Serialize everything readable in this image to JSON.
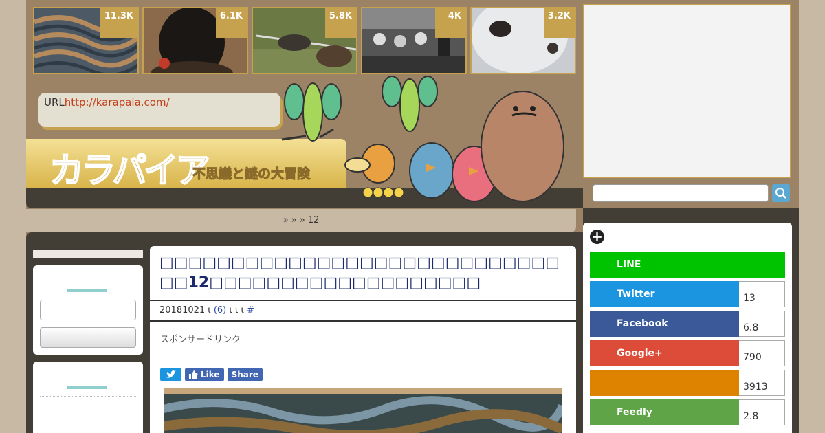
{
  "thumbnails": [
    {
      "count": "11.3K",
      "icon": "terraced-landscape"
    },
    {
      "count": "6.1K",
      "icon": "back-of-head"
    },
    {
      "count": "5.8K",
      "icon": "animals-fence"
    },
    {
      "count": "4K",
      "icon": "vintage-photo"
    },
    {
      "count": "3.2K",
      "icon": "husky-nose"
    }
  ],
  "header": {
    "url_label": "URL",
    "url_link": "http://karapaia.com/",
    "logo": "カラパイア",
    "tagline": "不思議と謎の大冒険"
  },
  "breadcrumb": "»  »     » 12",
  "article": {
    "title": "□□□□□□□□□□□□□□□□□□□□□□□□□□□□□□12□□□□□□□□□□□□□□□□□□□",
    "meta_date": "20181021 ι ",
    "meta_comments": "(6)",
    "meta_rest": " ι  ι     ι ",
    "meta_hash": "#",
    "sponsor": "スポンサードリンク",
    "share_like": "Like",
    "share_share": "Share"
  },
  "social": [
    {
      "name": "LINE",
      "count": "",
      "color": "#00c300"
    },
    {
      "name": "Twitter",
      "count": "13",
      "color": "#1b95e0"
    },
    {
      "name": "Facebook",
      "count": "6.8",
      "color": "#3b5998"
    },
    {
      "name": "Google+",
      "count": "790",
      "color": "#dd4b39"
    },
    {
      "name": "",
      "count": "3913",
      "color": "#dd8300"
    },
    {
      "name": "Feedly",
      "count": "2.8",
      "color": "#5fa547"
    }
  ]
}
